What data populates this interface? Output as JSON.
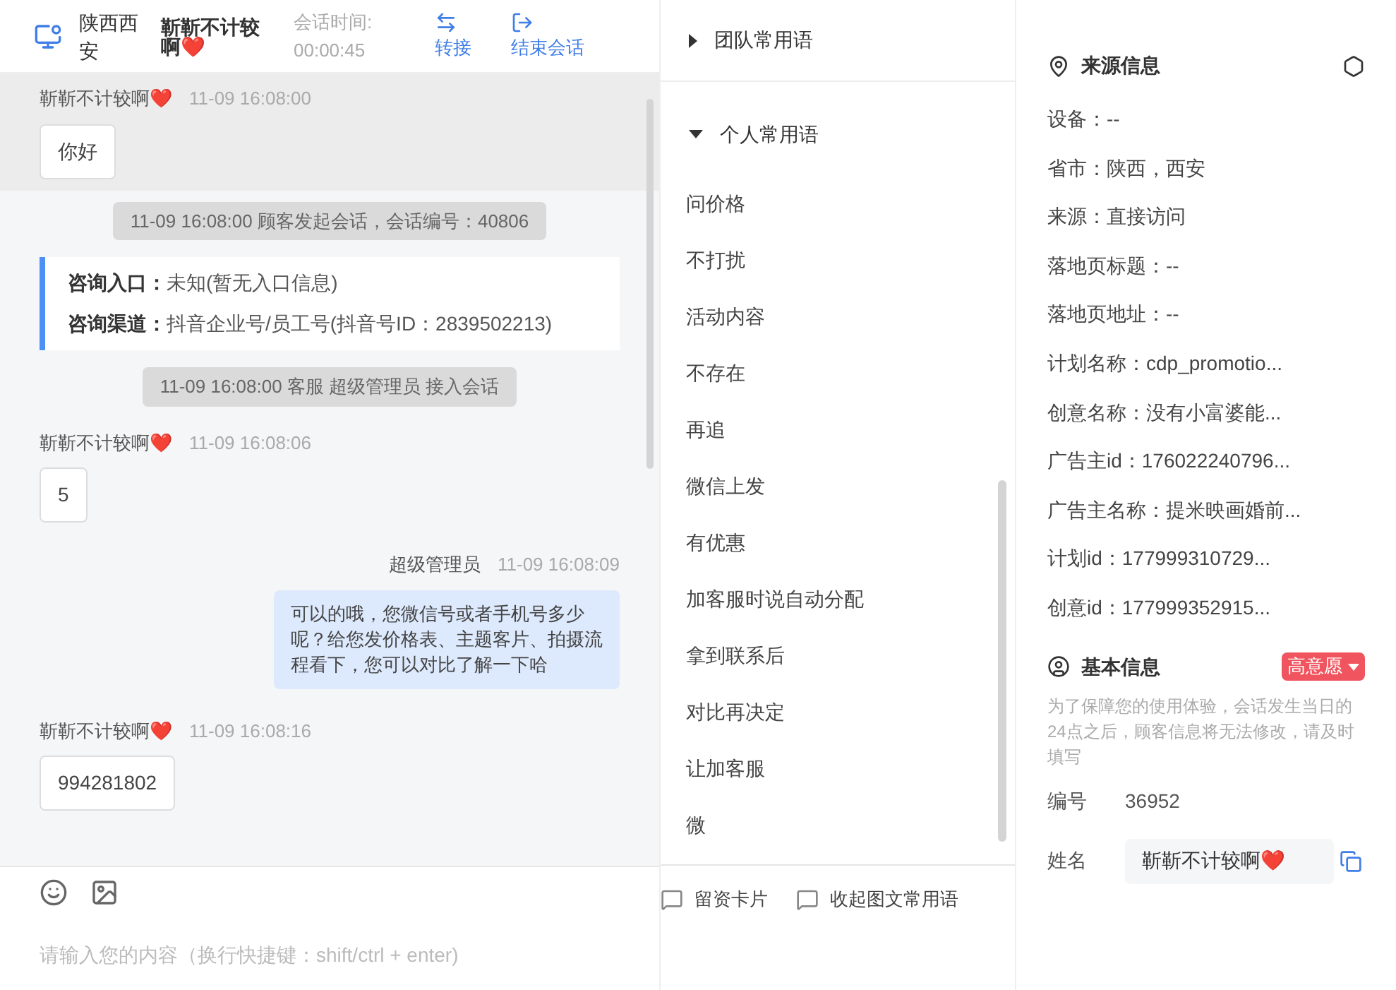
{
  "header": {
    "location": "陕西西安",
    "customer": "靳靳不计较啊❤️",
    "timer_label": "会话时间:",
    "timer": "00:00:45",
    "actions": [
      {
        "kind": "transfer",
        "label": "转接"
      },
      {
        "kind": "end",
        "label": "结束会话"
      }
    ]
  },
  "messages": [
    {
      "kind": "customer",
      "sender": "靳靳不计较啊❤️",
      "time": "11-09 16:08:00",
      "text": "你好",
      "selected": true
    },
    {
      "kind": "system",
      "text": "11-09 16:08:00 顾客发起会话，会话编号：40806"
    },
    {
      "kind": "entry",
      "lines": [
        {
          "label": "咨询入口：",
          "value": "未知(暂无入口信息)"
        },
        {
          "label": "咨询渠道：",
          "value": "抖音企业号/员工号(抖音号ID：2839502213)"
        }
      ]
    },
    {
      "kind": "system",
      "text": "11-09 16:08:00 客服 超级管理员 接入会话"
    },
    {
      "kind": "customer",
      "sender": "靳靳不计较啊❤️",
      "time": "11-09 16:08:06",
      "text": "5",
      "selected": false
    },
    {
      "kind": "agent",
      "sender": "超级管理员",
      "time": "11-09 16:08:09",
      "text": "可以的哦，您微信号或者手机号多少呢？给您发价格表、主题客片、拍摄流程看下，您可以对比了解一下哈"
    },
    {
      "kind": "customer",
      "sender": "靳靳不计较啊❤️",
      "time": "11-09 16:08:16",
      "text": "994281802",
      "selected": false
    }
  ],
  "composer": {
    "placeholder": "请输入您的内容（换行快捷键：shift/ctrl + enter)",
    "tools": [
      {
        "label": "留资卡片"
      },
      {
        "label": "收起图文常用语"
      }
    ]
  },
  "phrases": {
    "groups": [
      {
        "label": "团队常用语",
        "expanded": false
      },
      {
        "label": "个人常用语",
        "expanded": true
      }
    ],
    "items": [
      "问价格",
      "不打扰",
      "活动内容",
      "不存在",
      "再追",
      "微信上发",
      "有优惠",
      "加客服时说自动分配",
      "拿到联系后",
      "对比再决定",
      "让加客服",
      "微"
    ]
  },
  "source_info": {
    "title": "来源信息",
    "rows": [
      "设备：--",
      "省市：陕西，西安",
      "来源：直接访问",
      "落地页标题：--",
      "落地页地址：--",
      "计划名称：cdp_promotio...",
      "创意名称：没有小富婆能...",
      "广告主id：176022240796...",
      "广告主名称：提米映画婚前...",
      "计划id：177999310729...",
      "创意id：177999352915..."
    ]
  },
  "basic_info": {
    "title": "基本信息",
    "intent_tag": {
      "label": "高意愿",
      "color": "#f0545e"
    },
    "note": "为了保障您的使用体验，会话发生当日的24点之后，顾客信息将无法修改，请及时填写",
    "id_label": "编号",
    "id_value": "36952",
    "name_label": "姓名",
    "name_value": "靳靳不计较啊❤️"
  }
}
